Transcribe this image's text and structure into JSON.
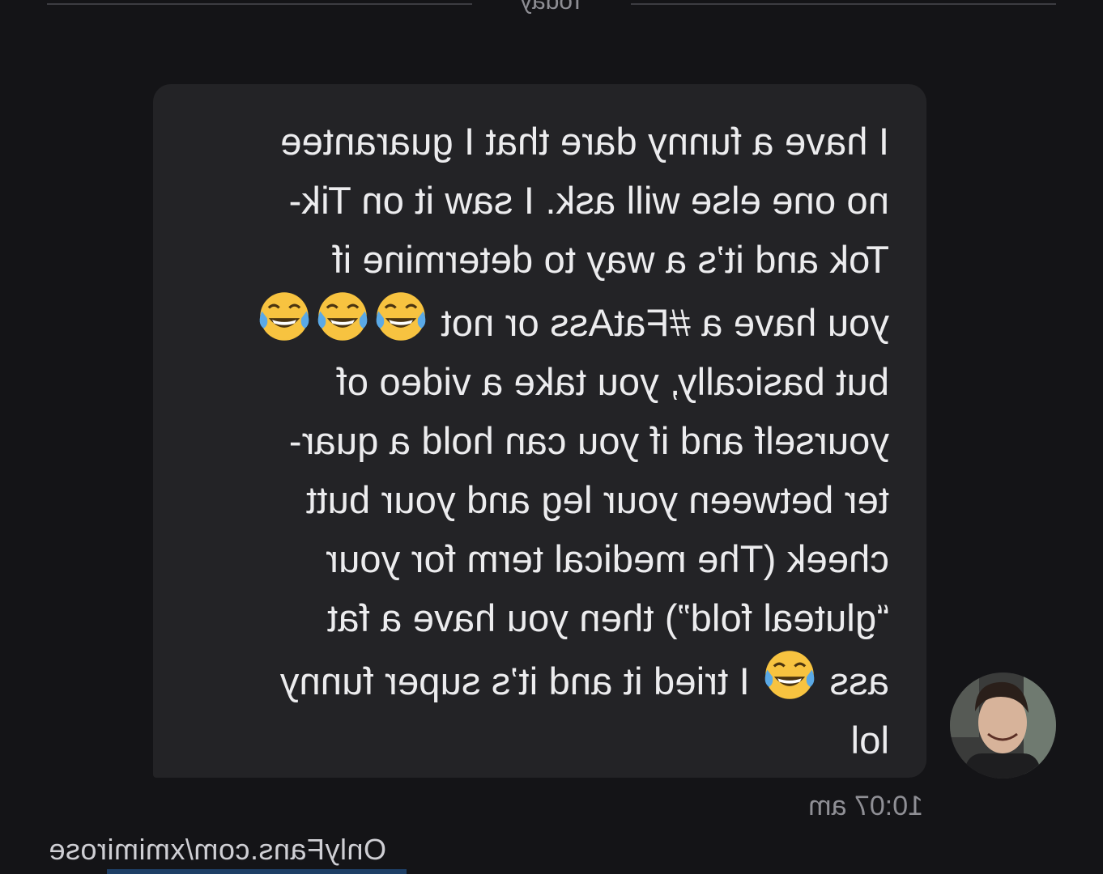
{
  "date_separator": {
    "label": "Today"
  },
  "message": {
    "text_parts": [
      "I have a funny dare that I guarantee\nno one else will ask. I saw it on Tik-\nTok and it’s a way to determine if\nyou have a #FatAss or not ",
      "\nbut basically, you take a video of\nyourself and if you can hold a quar-\nter between your leg and your butt\ncheek (The medical term for your\n“gluteal fold”) then you have a fat\nass ",
      " I tried it and it’s super funny\nlol"
    ],
    "emoji_name": "face-with-tears-of-joy-emoji",
    "timestamp": "10:07 am"
  },
  "watermark": {
    "text": "OnlyFans.com/xmimirose"
  },
  "colors": {
    "background": "#141417",
    "bubble": "#232326",
    "text": "#ececee",
    "muted": "#8f8f95",
    "emoji_face": "#f7c340",
    "emoji_tear": "#5aa9e6"
  }
}
